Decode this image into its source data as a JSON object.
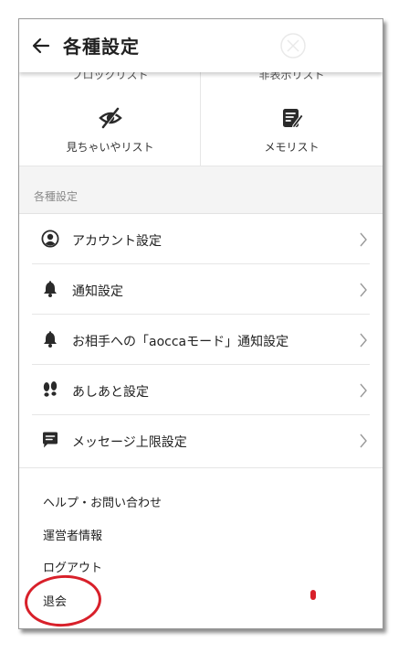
{
  "header": {
    "title": "各種設定"
  },
  "cutoff_row": {
    "left_text": "ブロックリスト",
    "right_text": "非表示リスト"
  },
  "grid": {
    "items": [
      {
        "label": "見ちゃいやリスト",
        "icon": "eye-slash-icon"
      },
      {
        "label": "メモリスト",
        "icon": "memo-pencil-icon"
      }
    ]
  },
  "section": {
    "label": "各種設定"
  },
  "settings": {
    "items": [
      {
        "label": "アカウント設定",
        "icon": "account-icon"
      },
      {
        "label": "通知設定",
        "icon": "bell-icon"
      },
      {
        "label": "お相手への「aoccaモード」通知設定",
        "icon": "bell-icon"
      },
      {
        "label": "あしあと設定",
        "icon": "footprints-icon"
      },
      {
        "label": "メッセージ上限設定",
        "icon": "message-icon"
      }
    ]
  },
  "links": {
    "help": "ヘルプ・お問い合わせ",
    "operator": "運営者情報",
    "logout": "ログアウト",
    "withdraw": "退会"
  },
  "colors": {
    "annotation_red": "#d8202a",
    "icon_dark": "#2a2a2a",
    "section_bg": "#f4f4f4"
  }
}
